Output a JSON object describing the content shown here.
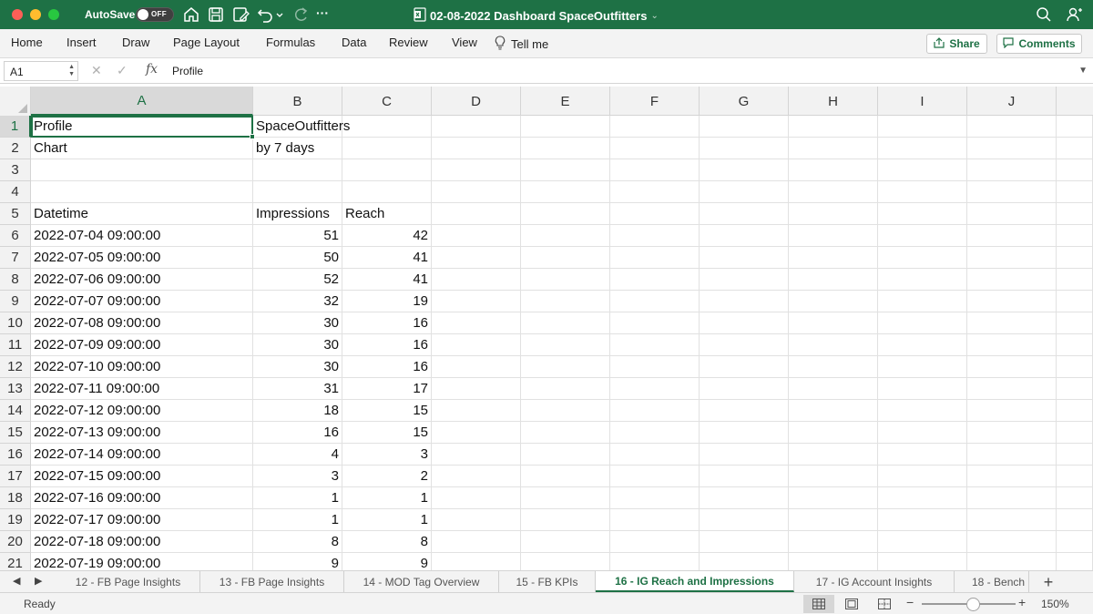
{
  "titlebar": {
    "autosave_label": "AutoSave",
    "autosave_state": "OFF",
    "document_title": "02-08-2022 Dashboard SpaceOutfitters",
    "title_chevron": "⌄",
    "more_label": "···"
  },
  "ribbon": {
    "tabs": [
      "Home",
      "Insert",
      "Draw",
      "Page Layout",
      "Formulas",
      "Data",
      "Review",
      "View"
    ],
    "tell_me": "Tell me",
    "share": "Share",
    "comments": "Comments"
  },
  "formula_bar": {
    "name_box": "A1",
    "fx": "fx",
    "content": "Profile"
  },
  "grid": {
    "columns": [
      "A",
      "B",
      "C",
      "D",
      "E",
      "F",
      "G",
      "H",
      "I",
      "J"
    ],
    "active_cell": "A1",
    "rows": [
      {
        "num": "1",
        "a": "Profile",
        "b": "SpaceOutfitters",
        "c": ""
      },
      {
        "num": "2",
        "a": "Chart",
        "b": "by 7 days",
        "c": ""
      },
      {
        "num": "3",
        "a": "",
        "b": "",
        "c": ""
      },
      {
        "num": "4",
        "a": "",
        "b": "",
        "c": ""
      },
      {
        "num": "5",
        "a": "Datetime",
        "b": "Impressions",
        "c": "Reach"
      },
      {
        "num": "6",
        "a": "2022-07-04 09:00:00",
        "b": "51",
        "c": "42"
      },
      {
        "num": "7",
        "a": "2022-07-05 09:00:00",
        "b": "50",
        "c": "41"
      },
      {
        "num": "8",
        "a": "2022-07-06 09:00:00",
        "b": "52",
        "c": "41"
      },
      {
        "num": "9",
        "a": "2022-07-07 09:00:00",
        "b": "32",
        "c": "19"
      },
      {
        "num": "10",
        "a": "2022-07-08 09:00:00",
        "b": "30",
        "c": "16"
      },
      {
        "num": "11",
        "a": "2022-07-09 09:00:00",
        "b": "30",
        "c": "16"
      },
      {
        "num": "12",
        "a": "2022-07-10 09:00:00",
        "b": "30",
        "c": "16"
      },
      {
        "num": "13",
        "a": "2022-07-11 09:00:00",
        "b": "31",
        "c": "17"
      },
      {
        "num": "14",
        "a": "2022-07-12 09:00:00",
        "b": "18",
        "c": "15"
      },
      {
        "num": "15",
        "a": "2022-07-13 09:00:00",
        "b": "16",
        "c": "15"
      },
      {
        "num": "16",
        "a": "2022-07-14 09:00:00",
        "b": "4",
        "c": "3"
      },
      {
        "num": "17",
        "a": "2022-07-15 09:00:00",
        "b": "3",
        "c": "2"
      },
      {
        "num": "18",
        "a": "2022-07-16 09:00:00",
        "b": "1",
        "c": "1"
      },
      {
        "num": "19",
        "a": "2022-07-17 09:00:00",
        "b": "1",
        "c": "1"
      },
      {
        "num": "20",
        "a": "2022-07-18 09:00:00",
        "b": "8",
        "c": "8"
      },
      {
        "num": "21",
        "a": "2022-07-19 09:00:00",
        "b": "9",
        "c": "9"
      }
    ]
  },
  "sheet_tabs": {
    "tabs": [
      "12 - FB Page Insights",
      "13 - FB Page Insights",
      "14 - MOD Tag Overview",
      "15 - FB KPIs",
      "16 - IG Reach and Impressions",
      "17 - IG Account Insights",
      "18 - Bench"
    ],
    "active_index": 4,
    "add_label": "+"
  },
  "status_bar": {
    "status": "Ready",
    "zoom": "150%",
    "zoom_minus": "−",
    "zoom_plus": "+"
  },
  "colors": {
    "accent": "#1e7145",
    "titlebar": "#1e7145"
  },
  "icons": [
    "close-window-icon",
    "minimize-window-icon",
    "maximize-window-icon",
    "home-icon",
    "save-icon",
    "save-as-icon",
    "undo-icon",
    "chevron-down-icon",
    "redo-icon",
    "more-icon",
    "excel-file-icon",
    "search-icon",
    "account-icon",
    "lightbulb-icon",
    "share-icon",
    "comment-icon",
    "normal-view-icon",
    "page-layout-view-icon",
    "page-break-view-icon"
  ]
}
